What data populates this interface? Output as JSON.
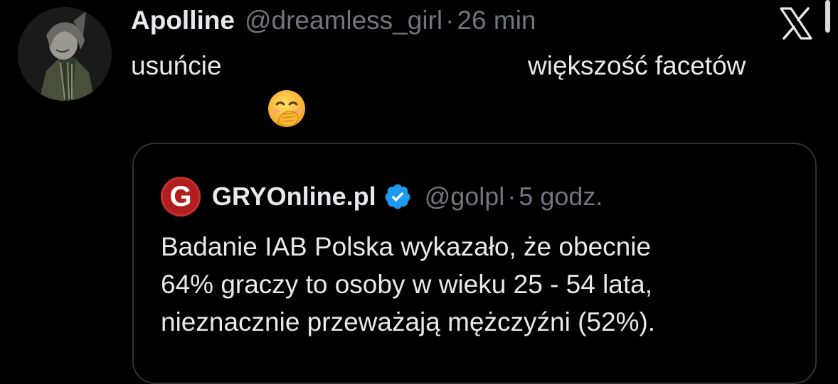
{
  "tweet": {
    "author_name": "Apolline",
    "author_handle": "@dreamless_girl",
    "separator": "·",
    "time": "26 min",
    "text_part1": "usuńcie",
    "text_part2": "większość facetów",
    "emoji": "🤭",
    "icons": {
      "avatar": "avatar-image",
      "platform_logo": "x-logo-icon",
      "emoji_icon": "face-with-hand-over-mouth-icon"
    }
  },
  "quoted_tweet": {
    "avatar_letter": "G",
    "author_name": "GRYOnline.pl",
    "verified_icon": "verified-badge-icon",
    "author_handle": "@golpl",
    "separator": "·",
    "time": "5 godz.",
    "text_lines": [
      "Badanie IAB Polska wykazało, że obecnie",
      "64% graczy to osoby w wieku 25 - 54 lata,",
      "nieznacznie przeważają mężczyźni (52%)."
    ]
  },
  "colors": {
    "background": "#000000",
    "primary_text": "#e7e9ea",
    "secondary_text": "#71767b",
    "card_border": "#2f3336",
    "verified_blue": "#1d9bf0",
    "gry_red": "#b01e1e"
  }
}
